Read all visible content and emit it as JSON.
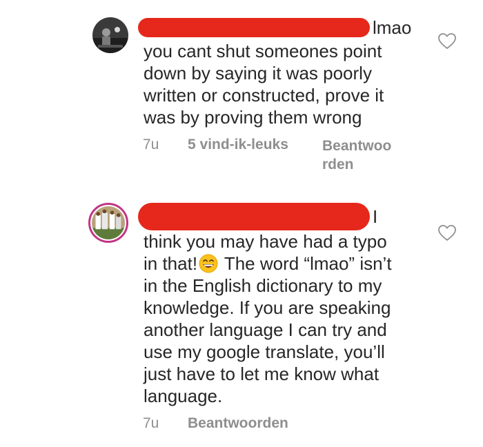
{
  "comments": [
    {
      "name_tail": "lmao",
      "body": "you cant shut someones point\ndown by saying it was poorly\nwritten or constructed, prove it\nwas by proving them wrong",
      "time": "7u",
      "likes": "5 vind-ik-leuks",
      "reply": "Beantwoo\nrden",
      "avatar_icon": "profile-photo-dark",
      "like_icon": "heart-outline-icon"
    },
    {
      "name_tail": "I",
      "body_line1": "think you may have had a typo",
      "body_line2a": "in that!",
      "emoji_icon": "grinning-face-emoji",
      "body_line2b": " The word “lmao” isn’t",
      "body_rest": "in the English dictionary to my\nknowledge. If you are speaking\nanother language I can try and\nuse my google translate, you’ll\njust have to let me know what\nlanguage.",
      "time": "7u",
      "reply": "Beantwoorden",
      "avatar_icon": "profile-photo-team",
      "like_icon": "heart-outline-icon"
    }
  ],
  "colors": {
    "redaction": "#e5281b",
    "meta_text": "#8e8e8e",
    "story_ring": "#c13584"
  }
}
